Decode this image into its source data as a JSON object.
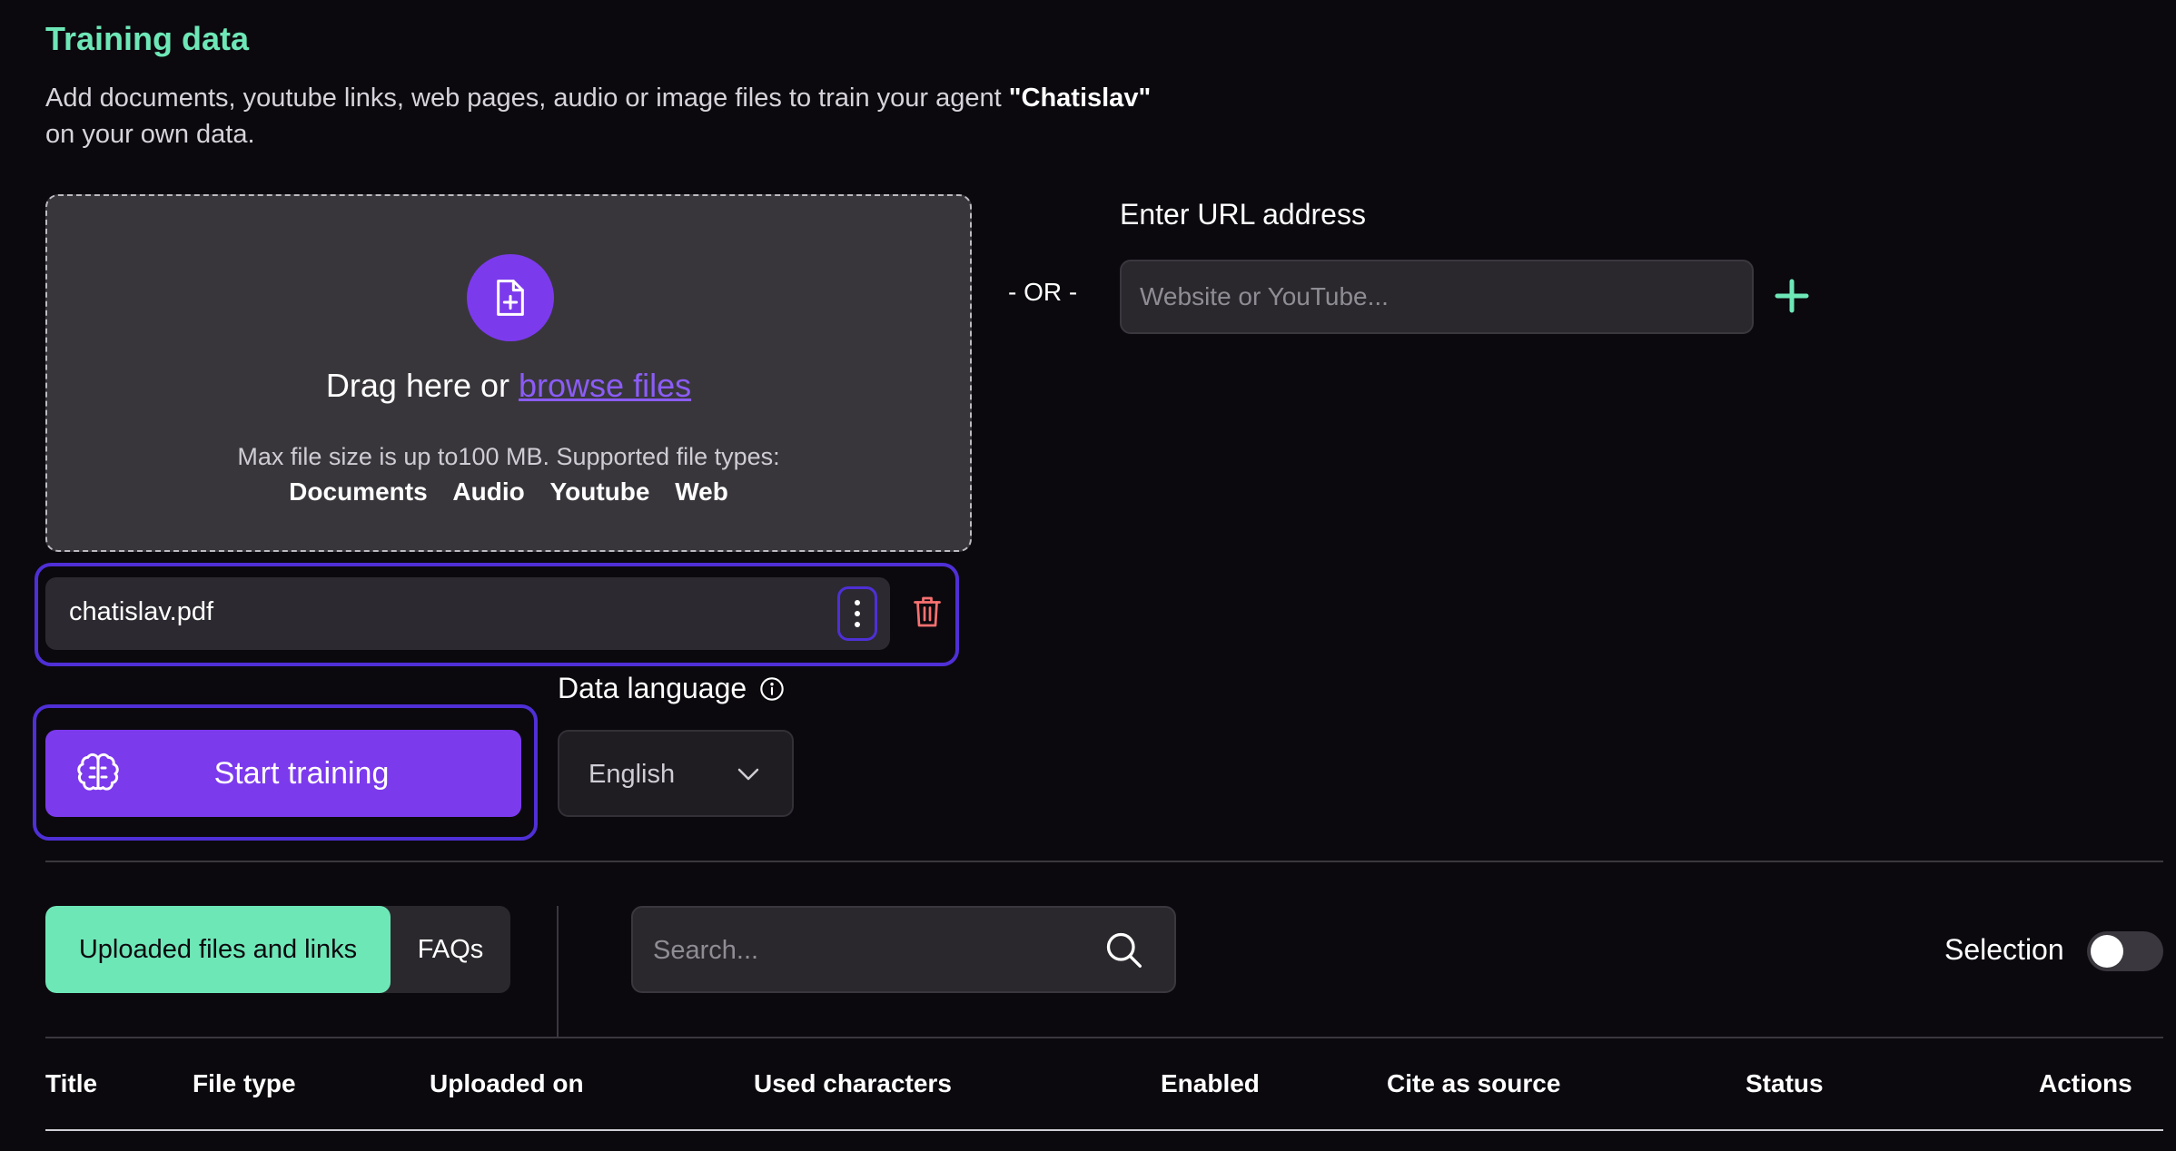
{
  "header": {
    "title": "Training data",
    "description_prefix": "Add documents, youtube links, web pages, audio or image files to train your agent ",
    "agent_name": "\"Chatislav\"",
    "description_suffix": "on your own data."
  },
  "upload": {
    "drag_text": "Drag here or ",
    "browse_link": "browse files",
    "max_size": "Max file size is up to100 MB. Supported file types:",
    "file_types": [
      "Documents",
      "Audio",
      "Youtube",
      "Web"
    ]
  },
  "or_label": "- OR -",
  "url": {
    "label": "Enter URL address",
    "placeholder": "Website or YouTube..."
  },
  "file": {
    "name": "chatislav.pdf"
  },
  "training": {
    "start_label": "Start training"
  },
  "language": {
    "label": "Data language",
    "selected": "English"
  },
  "tabs": {
    "uploaded": "Uploaded files and links",
    "faqs": "FAQs"
  },
  "search": {
    "placeholder": "Search..."
  },
  "selection_label": "Selection",
  "table": {
    "columns": [
      "Title",
      "File type",
      "Uploaded on",
      "Used characters",
      "Enabled",
      "Cite as source",
      "Status",
      "Actions"
    ]
  },
  "colors": {
    "accent_green": "#6ee7b7",
    "accent_purple": "#7c3aed",
    "danger": "#f87171"
  }
}
